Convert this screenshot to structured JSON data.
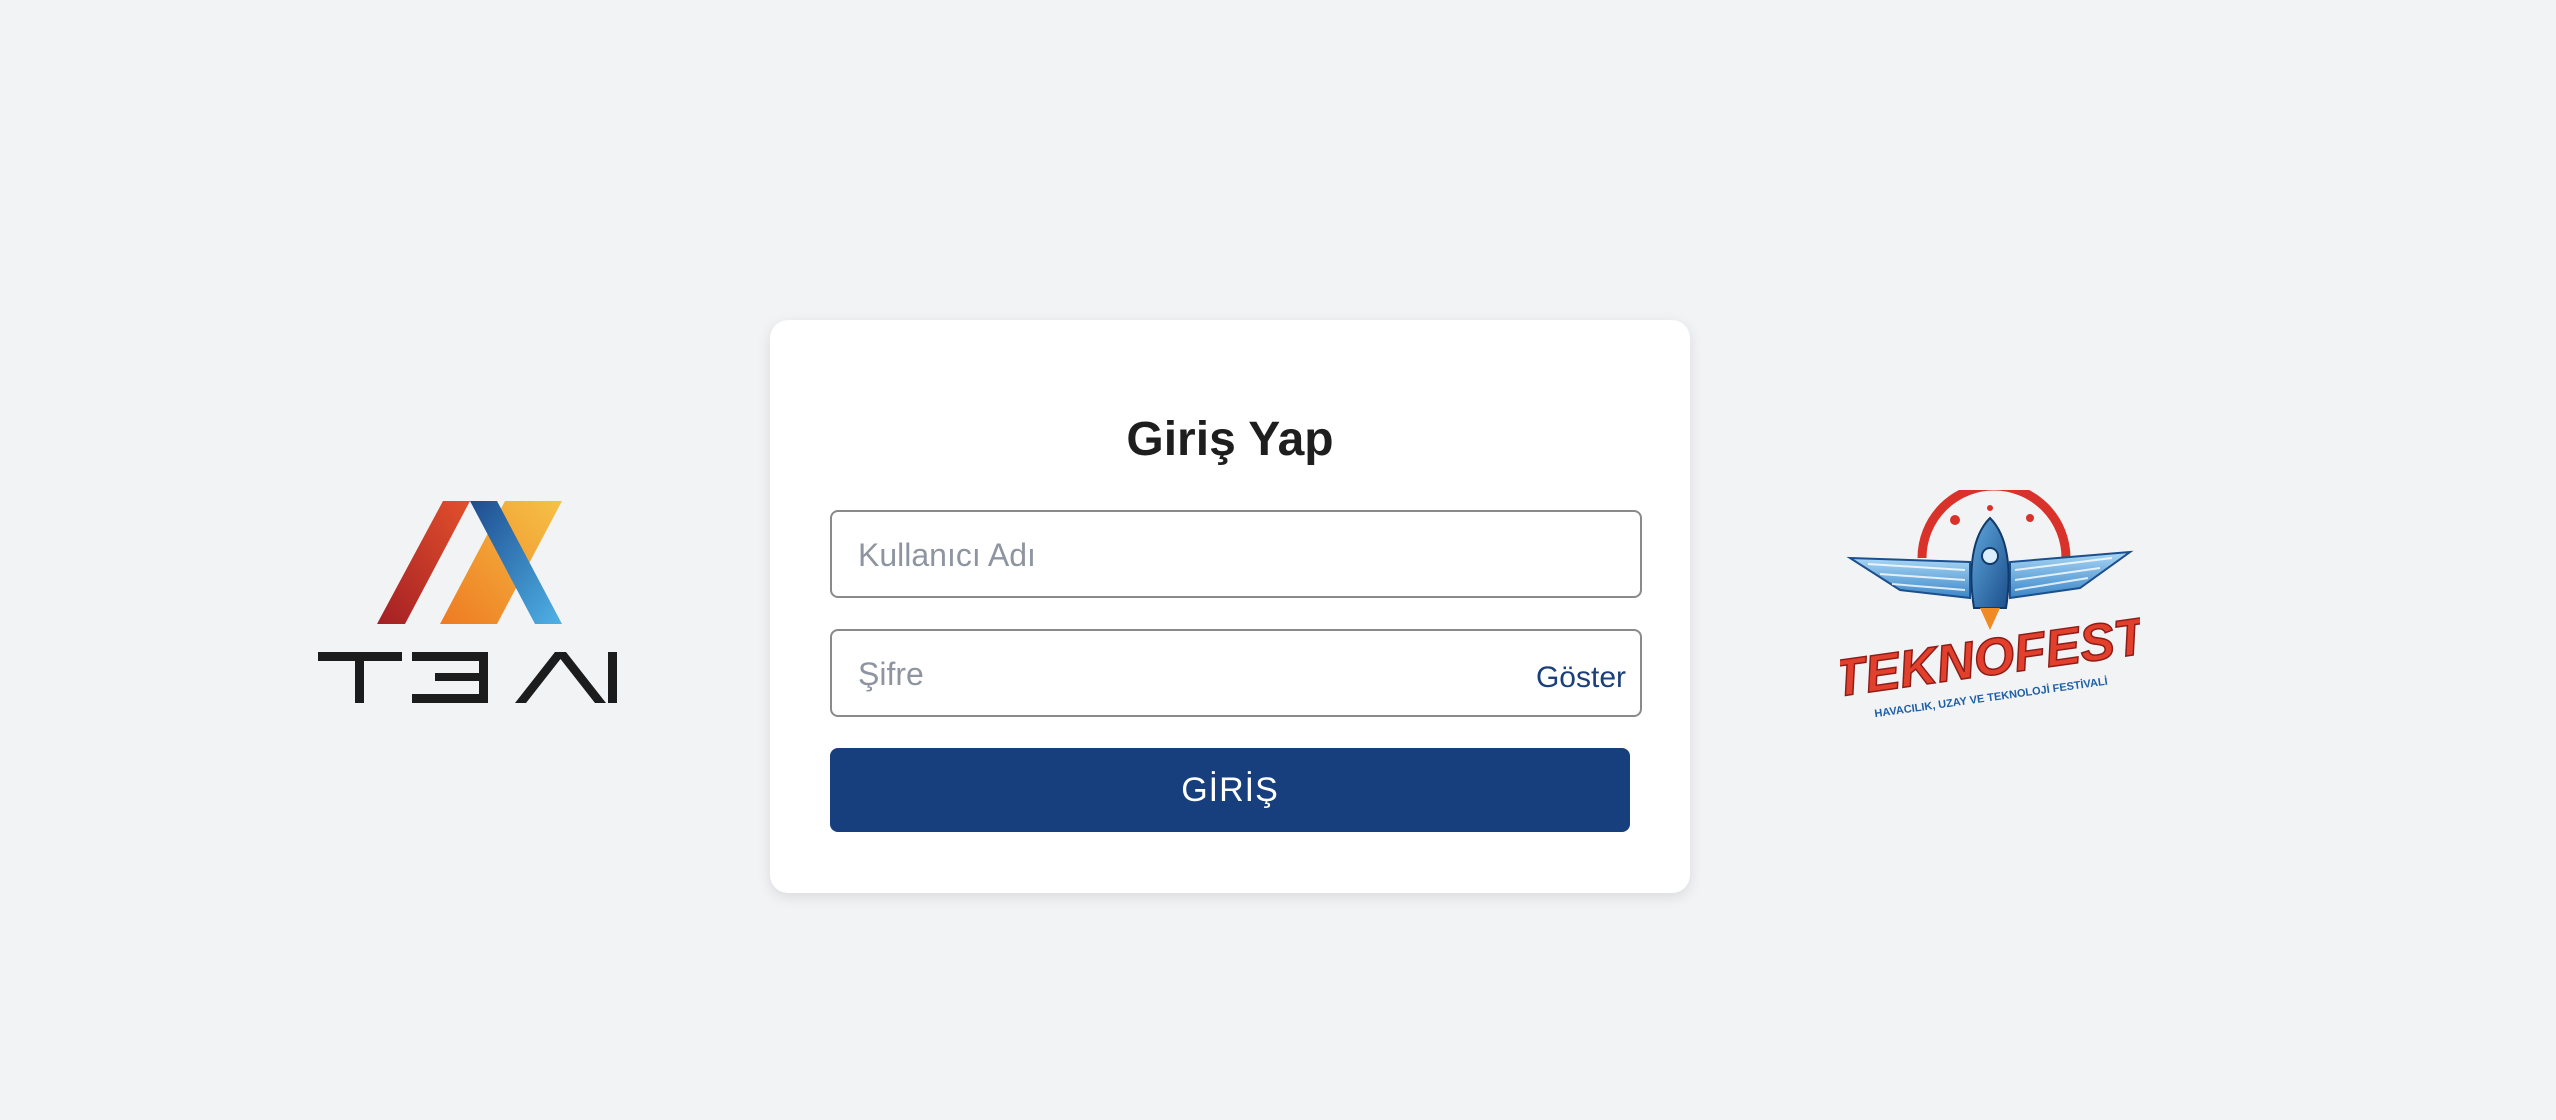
{
  "login": {
    "title": "Giriş Yap",
    "username_placeholder": "Kullanıcı Adı",
    "username_value": "",
    "password_placeholder": "Şifre",
    "password_value": "",
    "show_password_label": "Göster",
    "submit_label": "GİRİŞ"
  },
  "logos": {
    "left": {
      "text": "T3 AI",
      "icon": "t3-ai-logo"
    },
    "right": {
      "text": "TEKNOFEST",
      "subtitle": "HAVACILIK, UZAY VE TEKNOLOJİ FESTİVALİ",
      "icon": "teknofest-logo"
    }
  },
  "colors": {
    "background": "#f2f3f5",
    "primary": "#173e7d",
    "card": "#ffffff",
    "link": "#1a3f7a"
  }
}
